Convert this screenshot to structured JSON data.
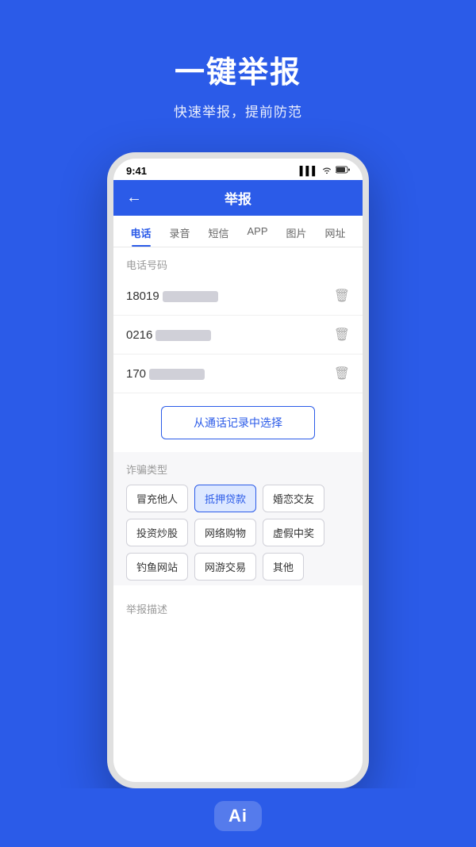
{
  "background_color": "#2b5be8",
  "header": {
    "main_title": "一键举报",
    "sub_title": "快速举报，提前防范"
  },
  "status_bar": {
    "time": "9:41",
    "signal": "▌▌▌",
    "wifi": "▲",
    "battery": "▓"
  },
  "nav": {
    "back_label": "←",
    "title": "举报"
  },
  "tabs": [
    {
      "label": "电话",
      "active": true
    },
    {
      "label": "录音",
      "active": false
    },
    {
      "label": "短信",
      "active": false
    },
    {
      "label": "APP",
      "active": false
    },
    {
      "label": "图片",
      "active": false
    },
    {
      "label": "网址",
      "active": false
    }
  ],
  "phone_section": {
    "label": "电话号码",
    "phones": [
      {
        "number": "18019",
        "blur": true
      },
      {
        "number": "0216",
        "blur": true
      },
      {
        "number": "170",
        "blur": true
      }
    ],
    "select_btn": "从通话记录中选择"
  },
  "fraud_section": {
    "label": "诈骗类型",
    "tags": [
      {
        "label": "冒充他人",
        "active": false
      },
      {
        "label": "抵押贷款",
        "active": true
      },
      {
        "label": "婚恋交友",
        "active": false
      },
      {
        "label": "投资炒股",
        "active": false
      },
      {
        "label": "网络购物",
        "active": false
      },
      {
        "label": "虚假中奖",
        "active": false
      },
      {
        "label": "钓鱼网站",
        "active": false
      },
      {
        "label": "网游交易",
        "active": false
      },
      {
        "label": "其他",
        "active": false
      }
    ]
  },
  "desc_section": {
    "label": "举报描述"
  },
  "ai_badge": {
    "label": "Ai"
  }
}
